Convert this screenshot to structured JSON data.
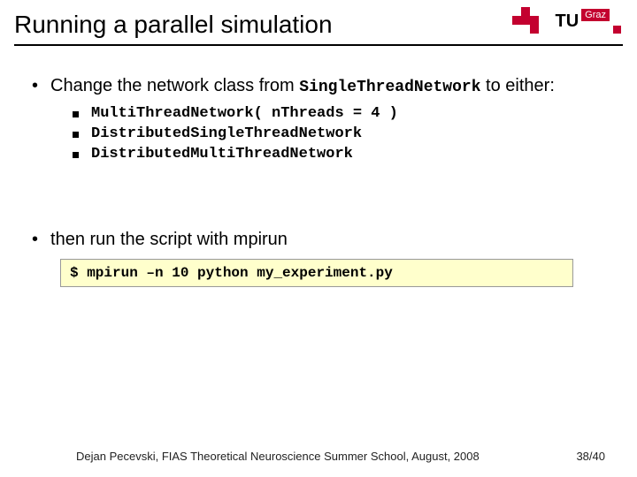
{
  "header": {
    "title": "Running a parallel simulation",
    "logo_text": "TU",
    "logo_sub": "Graz"
  },
  "main": {
    "bullet1_pre": "Change the network class from ",
    "bullet1_code": "SingleThreadNetwork",
    "bullet1_post": " to either:",
    "sub_items": [
      "MultiThreadNetwork( nThreads = 4 )",
      "DistributedSingleThreadNetwork",
      "DistributedMultiThreadNetwork"
    ],
    "bullet2": "then run the script with mpirun",
    "code_box": "$ mpirun –n 10 python my_experiment.py"
  },
  "footer": {
    "text": "Dejan Pecevski, FIAS Theoretical Neuroscience Summer School, August, 2008",
    "page": "38/40"
  }
}
